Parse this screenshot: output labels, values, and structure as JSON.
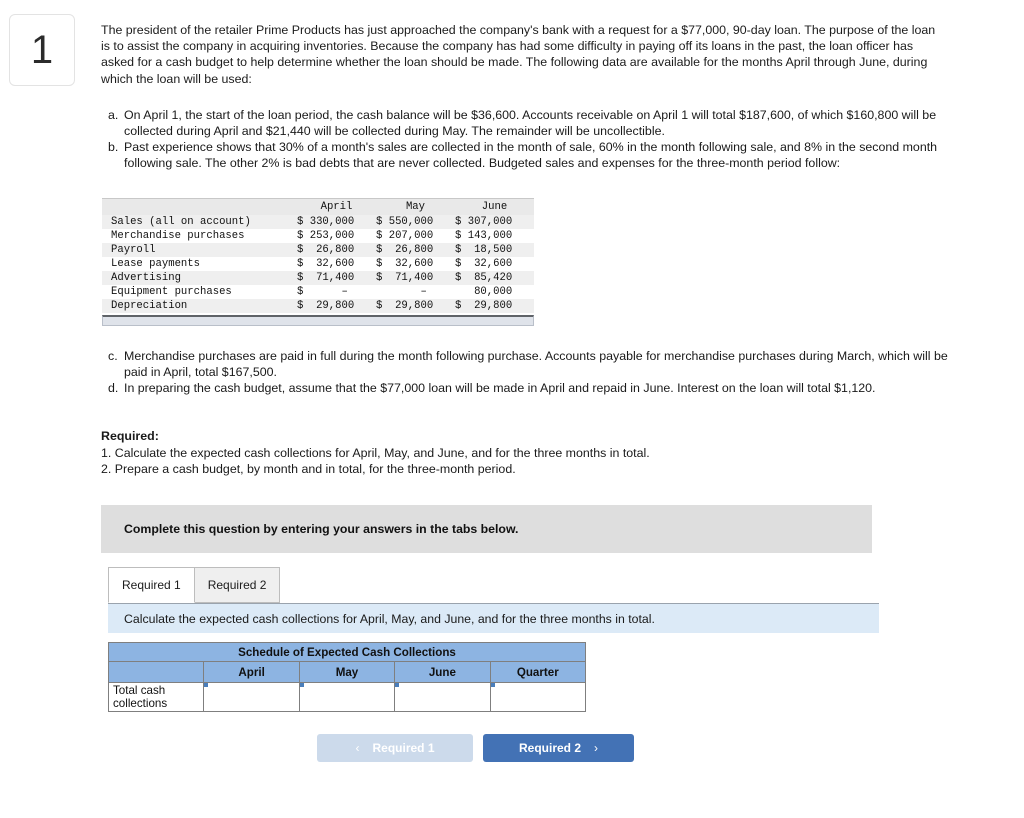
{
  "question_number": "1",
  "intro_paragraph": "The president of the retailer Prime Products has just approached the company's bank with a request for a $77,000, 90-day loan. The purpose of the loan is to assist the company in acquiring inventories. Because the company has had some difficulty in paying off its loans in the past, the loan officer has asked for a cash budget to help determine whether the loan should be made. The following data are available for the months April through June, during which the loan will be used:",
  "items_ab": [
    {
      "letter": "a.",
      "text": "On April 1, the start of the loan period, the cash balance will be $36,600. Accounts receivable on April 1 will total $187,600, of which $160,800 will be collected during April and $21,440 will be collected during May. The remainder will be uncollectible."
    },
    {
      "letter": "b.",
      "text": "Past experience shows that 30% of a month's sales are collected in the month of sale, 60% in the month following sale, and 8% in the second month following sale. The other 2% is bad debts that are never collected. Budgeted sales and expenses for the three-month period follow:"
    }
  ],
  "items_cd": [
    {
      "letter": "c.",
      "text": "Merchandise purchases are paid in full during the month following purchase. Accounts payable for merchandise purchases during March, which will be paid in April, total $167,500."
    },
    {
      "letter": "d.",
      "text": "In preparing the cash budget, assume that the $77,000 loan will be made in April and repaid in June. Interest on the loan will total $1,120."
    }
  ],
  "budget_table": {
    "columns": [
      "",
      "April",
      "May",
      "June"
    ],
    "rows": [
      {
        "label": "Sales (all on account)",
        "april": "$ 330,000",
        "may": "$ 550,000",
        "june": "$ 307,000"
      },
      {
        "label": "Merchandise purchases",
        "april": "$ 253,000",
        "may": "$ 207,000",
        "june": "$ 143,000"
      },
      {
        "label": "Payroll",
        "april": "$  26,800",
        "may": "$  26,800",
        "june": "$  18,500"
      },
      {
        "label": "Lease payments",
        "april": "$  32,600",
        "may": "$  32,600",
        "june": "$  32,600"
      },
      {
        "label": "Advertising",
        "april": "$  71,400",
        "may": "$  71,400",
        "june": "$  85,420"
      },
      {
        "label": "Equipment purchases",
        "april": "$      –",
        "may": "       –",
        "june": "   80,000"
      },
      {
        "label": "Depreciation",
        "april": "$  29,800",
        "may": "$  29,800",
        "june": "$  29,800"
      }
    ]
  },
  "required": {
    "title": "Required:",
    "lines": [
      "1. Calculate the expected cash collections for April, May, and June, and for the three months in total.",
      "2. Prepare a cash budget, by month and in total, for the three-month period."
    ]
  },
  "gray_banner_text": "Complete this question by entering your answers in the tabs below.",
  "tabs": [
    {
      "label": "Required 1",
      "active": true
    },
    {
      "label": "Required 2",
      "active": false
    }
  ],
  "blue_banner_text": "Calculate the expected cash collections for April, May, and June, and for the three months in total.",
  "schedule": {
    "title": "Schedule of Expected Cash Collections",
    "columns": [
      "",
      "April",
      "May",
      "June",
      "Quarter"
    ],
    "row_label": "Total cash collections",
    "values": [
      "",
      "",
      "",
      ""
    ]
  },
  "nav": {
    "prev_label": "Required 1",
    "prev_chevron": "‹",
    "next_label": "Required 2",
    "next_chevron": "›"
  },
  "colors": {
    "header_blue": "#8db4e2",
    "banner_blue": "#dceaf7",
    "banner_gray": "#dedede",
    "button_blue": "#4372b5",
    "button_disabled": "#ccdaeb",
    "input_border": "#4a7ebb"
  }
}
